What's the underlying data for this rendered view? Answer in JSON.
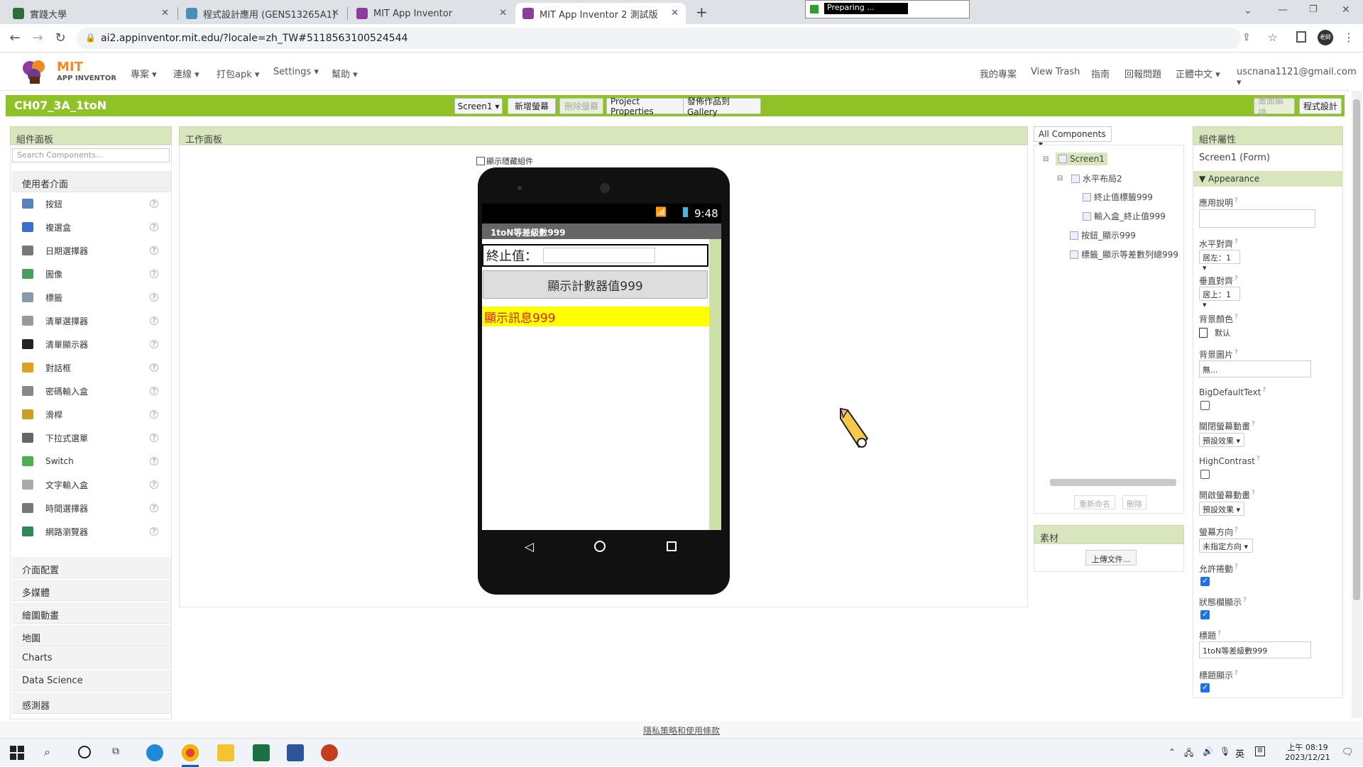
{
  "browser": {
    "tabs": [
      {
        "title": "實踐大學"
      },
      {
        "title": "程式設計應用 (GENS13265A1)"
      },
      {
        "title": "MIT App Inventor"
      },
      {
        "title": "MIT App Inventor 2 測試版"
      }
    ],
    "url": "ai2.appinventor.mit.edu/?locale=zh_TW#5118563100524544",
    "loading_popup": "Preparing ...",
    "profile_badge": "老師"
  },
  "app_header": {
    "logo_line1": "MIT",
    "logo_line2": "APP INVENTOR",
    "menus": [
      "專案",
      "連線",
      "打包apk",
      "Settings",
      "幫助"
    ],
    "right_links": [
      "我的專案",
      "View Trash",
      "指南",
      "回報問題",
      "正體中文"
    ],
    "account": "uscnana1121@gmail.com"
  },
  "toolbar": {
    "project_name": "CH07_3A_1toN",
    "screen_select": "Screen1",
    "add_screen": "新增螢幕",
    "remove_screen": "刪除螢幕",
    "project_properties": "Project Properties",
    "publish_gallery": "發佈作品到Gallery",
    "designer": "畫面編排",
    "blocks": "程式設計"
  },
  "palette": {
    "header": "組件面板",
    "search_placeholder": "Search Components...",
    "ui_category": "使用者介面",
    "items": [
      {
        "label": "按鈕",
        "icon": "button-icon",
        "color": "#5b7fbf"
      },
      {
        "label": "複選盒",
        "icon": "checkbox-icon",
        "color": "#3b6fd8"
      },
      {
        "label": "日期選擇器",
        "icon": "datepicker-icon",
        "color": "#777777"
      },
      {
        "label": "圖像",
        "icon": "image-icon",
        "color": "#4aa05a"
      },
      {
        "label": "標籤",
        "icon": "label-icon",
        "color": "#8899aa"
      },
      {
        "label": "清單選擇器",
        "icon": "listpicker-icon",
        "color": "#999999"
      },
      {
        "label": "清單顯示器",
        "icon": "listview-icon",
        "color": "#222222"
      },
      {
        "label": "對話框",
        "icon": "notifier-icon",
        "color": "#e0a020"
      },
      {
        "label": "密碼輸入盒",
        "icon": "password-icon",
        "color": "#888888"
      },
      {
        "label": "滑桿",
        "icon": "slider-icon",
        "color": "#c9a020"
      },
      {
        "label": "下拉式選單",
        "icon": "spinner-icon",
        "color": "#666666"
      },
      {
        "label": "Switch",
        "icon": "switch-icon",
        "color": "#4caf50"
      },
      {
        "label": "文字輸入盒",
        "icon": "textbox-icon",
        "color": "#aaaaaa"
      },
      {
        "label": "時間選擇器",
        "icon": "timepicker-icon",
        "color": "#777777"
      },
      {
        "label": "網路瀏覽器",
        "icon": "webviewer-icon",
        "color": "#2e8b57"
      }
    ],
    "categories": [
      "介面配置",
      "多媒體",
      "繪圖動畫",
      "地圖",
      "Charts",
      "Data Science",
      "感測器"
    ]
  },
  "viewer": {
    "header": "工作面板",
    "show_hidden": "顯示隱藏組件",
    "status_time": "9:48",
    "app_title": "1toN等差級數999",
    "label_end": "終止值：",
    "button_text": "顯示計數器值999",
    "message_text": "顯示訊息999",
    "message_bg": "#ffff00",
    "message_color": "#e0201c"
  },
  "components": {
    "filter": "All Components",
    "tree": [
      {
        "label": "Screen1"
      },
      {
        "label": "水平布局2"
      },
      {
        "label": "終止值標籤999"
      },
      {
        "label": "輸入盒_終止值999"
      },
      {
        "label": "按鈕_顯示999"
      },
      {
        "label": "標籤_顯示等差數列總999"
      }
    ],
    "rename": "重新命名",
    "delete": "刪除",
    "media_header": "素材",
    "upload": "上傳文件..."
  },
  "properties": {
    "header": "組件屬性",
    "subject": "Screen1 (Form)",
    "section": "Appearance",
    "about_label": "應用說明",
    "align_h_label": "水平對齊",
    "align_h_value": "居左：1",
    "align_v_label": "垂直對齊",
    "align_v_value": "居上：1",
    "bg_color_label": "背景顏色",
    "bg_color_value": "默认",
    "bg_image_label": "背景圖片",
    "bg_image_value": "無...",
    "big_text_label": "BigDefaultText",
    "close_anim_label": "關閉螢幕動畫",
    "close_anim_value": "預設效果",
    "high_contrast_label": "HighContrast",
    "open_anim_label": "開啟螢幕動畫",
    "open_anim_value": "預設效果",
    "orientation_label": "螢幕方向",
    "orientation_value": "未指定方向",
    "scroll_label": "允許捲動",
    "statusbar_label": "狀態欄顯示",
    "title_label": "標題",
    "title_value": "1toN等差級數999",
    "title_visible_label": "標題顯示"
  },
  "footer": {
    "privacy": "隱私策略和使用條款"
  },
  "taskbar": {
    "time": "上午 08:19",
    "date": "2023/12/21",
    "ime": "英"
  }
}
